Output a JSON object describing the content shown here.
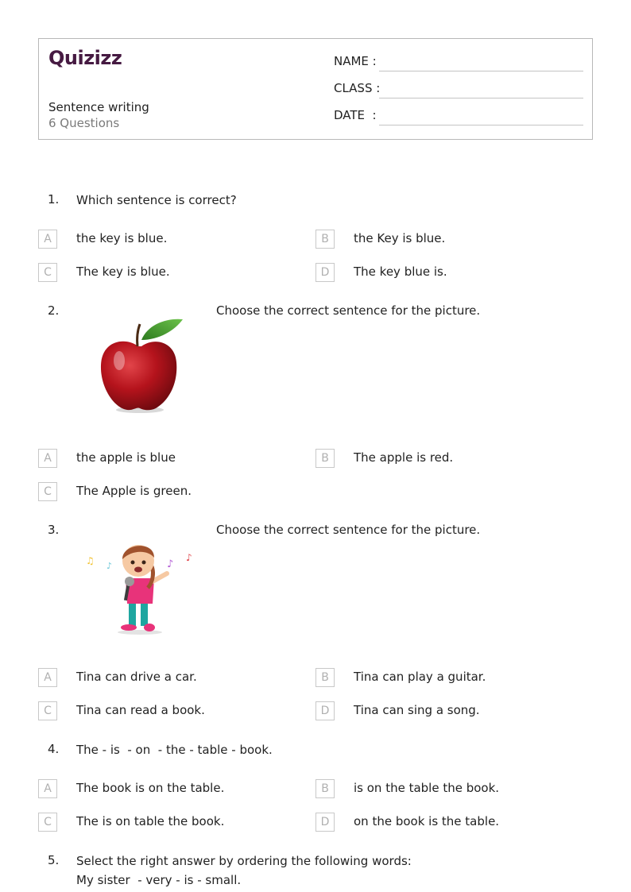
{
  "header": {
    "logo": "Quizizz",
    "worksheet_title": "Sentence writing",
    "question_count": "6 Questions",
    "fields": {
      "name_label": "NAME :",
      "class_label": "CLASS :",
      "date_label": "DATE  :"
    }
  },
  "colors": {
    "brand": "#461a42",
    "option_box_border": "#c8c8c8",
    "option_letter": "#b0b0b0"
  },
  "questions": [
    {
      "number": "1.",
      "text": "Which sentence is correct?",
      "options": [
        {
          "letter": "A",
          "text": "the key is blue."
        },
        {
          "letter": "B",
          "text": "the Key is blue."
        },
        {
          "letter": "C",
          "text": "The key is blue."
        },
        {
          "letter": "D",
          "text": "The key blue is."
        }
      ]
    },
    {
      "number": "2.",
      "text": "Choose the correct sentence for the picture.",
      "image": "red-apple",
      "options": [
        {
          "letter": "A",
          "text": "the apple is blue"
        },
        {
          "letter": "B",
          "text": "The apple is red."
        },
        {
          "letter": "C",
          "text": "The Apple is green."
        }
      ]
    },
    {
      "number": "3.",
      "text": "Choose the correct sentence for the picture.",
      "image": "girl-singing-with-microphone",
      "options": [
        {
          "letter": "A",
          "text": "Tina can drive a car."
        },
        {
          "letter": "B",
          "text": "Tina can play a guitar."
        },
        {
          "letter": "C",
          "text": "Tina can read a book."
        },
        {
          "letter": "D",
          "text": "Tina can sing a song."
        }
      ]
    },
    {
      "number": "4.",
      "text": "The - is  - on  - the - table - book.",
      "options": [
        {
          "letter": "A",
          "text": "The book is on the table."
        },
        {
          "letter": "B",
          "text": "is on the table the book."
        },
        {
          "letter": "C",
          "text": "The is on table the book."
        },
        {
          "letter": "D",
          "text": "on the book is the table."
        }
      ]
    },
    {
      "number": "5.",
      "text": "Select the right answer by ordering the following words:",
      "text_line2": "My sister  - very - is - small."
    }
  ]
}
